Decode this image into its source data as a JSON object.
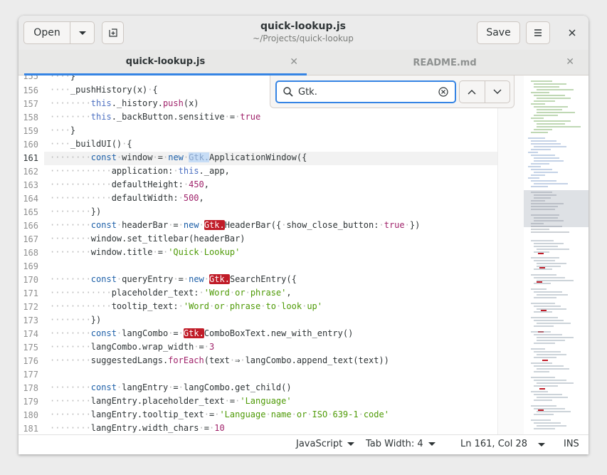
{
  "header": {
    "open_label": "Open",
    "title": "quick-lookup.js",
    "subtitle": "~/Projects/quick-lookup",
    "save_label": "Save",
    "menu_icon": "hamburger-menu-icon",
    "close_icon": "close-icon"
  },
  "tabs": [
    {
      "label": "quick-lookup.js",
      "active": true
    },
    {
      "label": "README.md",
      "active": false
    }
  ],
  "search": {
    "value": "Gtk."
  },
  "editor": {
    "current_line": 161,
    "partial_top_line": "155",
    "line_numbers": [
      "156",
      "157",
      "158",
      "159",
      "160",
      "161",
      "162",
      "163",
      "164",
      "165",
      "166",
      "167",
      "168",
      "169",
      "170",
      "171",
      "172",
      "173",
      "174",
      "175",
      "176",
      "177",
      "178",
      "179",
      "180",
      "181"
    ],
    "accent_color": "#3584e4",
    "match_color": "#c01c28"
  },
  "statusbar": {
    "language": "JavaScript",
    "tab_width": "Tab Width: 4",
    "position": "Ln 161, Col 28",
    "mode": "INS"
  }
}
